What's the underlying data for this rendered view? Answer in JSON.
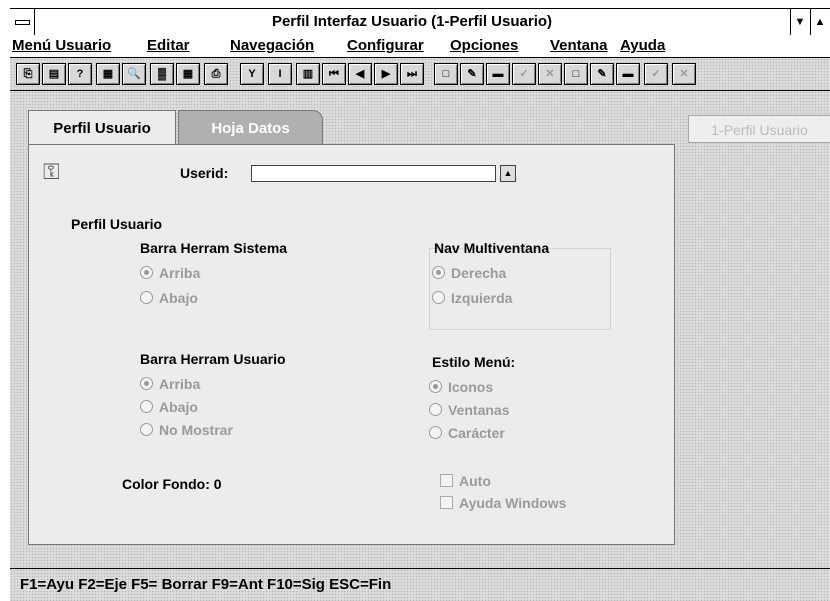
{
  "window": {
    "title": "Perfil Interfaz Usuario (1-Perfil Usuario)"
  },
  "menu": [
    "Menú Usuario",
    "Editar",
    "Navegación",
    "Configurar",
    "Opciones",
    "Ventana",
    "Ayuda"
  ],
  "tabs": {
    "active": "Perfil Usuario",
    "inactive": "Hoja Datos"
  },
  "instance_label": "1-Perfil Usuario",
  "form": {
    "userid_label": "Userid:",
    "userid_value": "",
    "section_title": "Perfil Usuario",
    "barra_sistema": {
      "title": "Barra Herram Sistema",
      "options": [
        "Arriba",
        "Abajo"
      ],
      "selected": "Arriba"
    },
    "nav_multiventana": {
      "title": "Nav Multiventana",
      "options": [
        "Derecha",
        "Izquierda"
      ],
      "selected": "Derecha"
    },
    "barra_usuario": {
      "title": "Barra Herram Usuario",
      "options": [
        "Arriba",
        "Abajo",
        "No Mostrar"
      ],
      "selected": "Arriba"
    },
    "estilo_menu": {
      "title": "Estilo Menú:",
      "options": [
        "Iconos",
        "Ventanas",
        "Carácter"
      ],
      "selected": "Iconos"
    },
    "color_fondo": "Color Fondo: 0",
    "checkboxes": [
      "Auto",
      "Ayuda Windows"
    ]
  },
  "status_bar": "F1=Ayu  F2=Eje  F5= Borrar  F9=Ant  F10=Sig  ESC=Fin",
  "toolbar_icons": [
    "copy-icon",
    "paste-icon",
    "help-cursor-icon",
    "doc-icon",
    "zoom-icon",
    "grid-icon",
    "table-icon",
    "print-icon",
    "filter-icon",
    "text-icon",
    "chart-icon",
    "first-icon",
    "prev-icon",
    "next-icon",
    "last-icon",
    "new-icon",
    "edit-icon",
    "delete-icon",
    "accept-icon",
    "cancel-icon"
  ]
}
